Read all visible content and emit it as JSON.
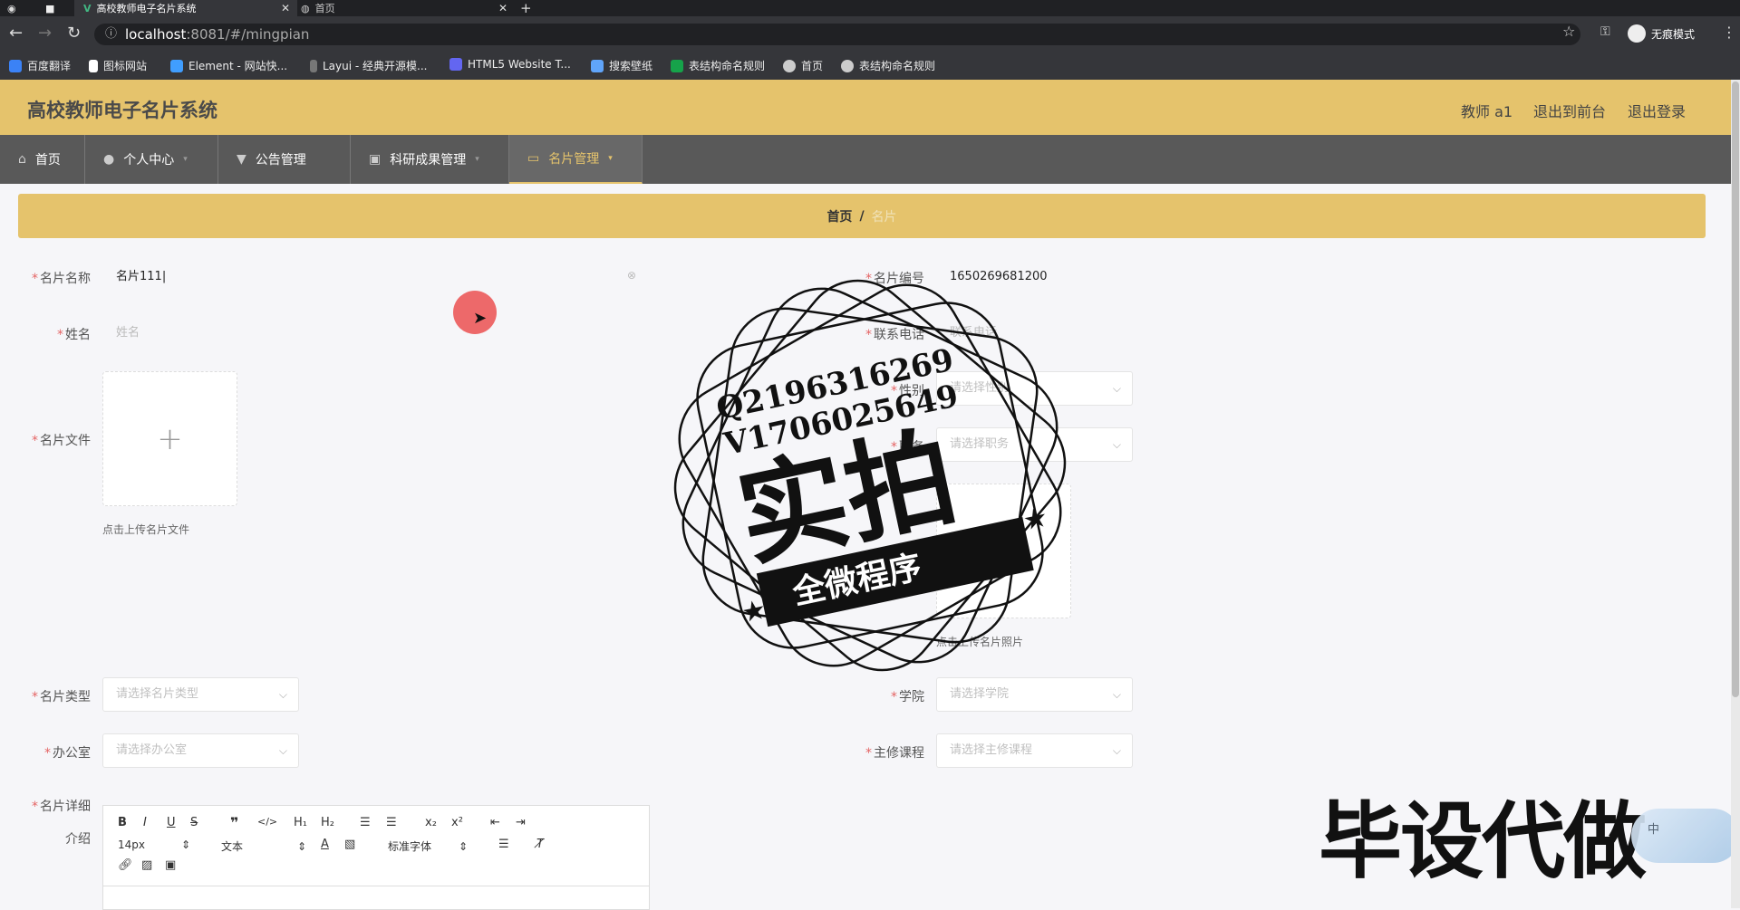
{
  "browser": {
    "tabs": [
      {
        "label": "高校教师电子名片系统",
        "active": true
      },
      {
        "label": "首页",
        "active": false
      }
    ],
    "url_host": "localhost",
    "url_path": ":8081/#/mingpian",
    "incognito_label": "无痕模式",
    "bookmarks": [
      "百度翻译",
      "图标网站",
      "Element - 网站快...",
      "Layui - 经典开源模...",
      "HTML5 Website T...",
      "搜索壁纸",
      "表结构命名规则",
      "首页",
      "表结构命名规则"
    ]
  },
  "header": {
    "title": "高校教师电子名片系统",
    "user": "教师 a1",
    "exit_front": "退出到前台",
    "logout": "退出登录"
  },
  "nav": {
    "items": [
      "首页",
      "个人中心",
      "公告管理",
      "科研成果管理",
      "名片管理"
    ],
    "active": "名片管理"
  },
  "breadcrumb": {
    "home": "首页",
    "sep": "/",
    "current": "名片"
  },
  "form": {
    "name_label": "名片名称",
    "name_value": "名片111",
    "number_label": "名片编号",
    "number_value": "1650269681200",
    "xingming_label": "姓名",
    "xingming_placeholder": "姓名",
    "phone_label": "联系电话",
    "phone_placeholder": "联系电话",
    "file_label": "名片文件",
    "file_hint": "点击上传名片文件",
    "gender_label": "性别",
    "gender_placeholder": "请选择性别",
    "duty_label": "职务",
    "duty_placeholder": "请选择职务",
    "photo_hint": "点击上传名片照片",
    "type_label": "名片类型",
    "type_placeholder": "请选择名片类型",
    "college_label": "学院",
    "college_placeholder": "请选择学院",
    "office_label": "办公室",
    "office_placeholder": "请选择办公室",
    "course_label": "主修课程",
    "course_placeholder": "请选择主修课程",
    "detail_label_1": "名片详细",
    "detail_label_2": "介绍"
  },
  "editor": {
    "size": "14px",
    "format": "文本",
    "font": "标准字体"
  },
  "overlay": {
    "stamp_line1": "Q2196316269",
    "stamp_line2": "V1706025649",
    "stamp_big": "实拍",
    "stamp_ribbon": "全微程序",
    "corner_text": "毕设代做",
    "ball_text": "中"
  },
  "colors": {
    "accent": "#e5c36c",
    "nav": "#595959",
    "required": "#e46464"
  }
}
